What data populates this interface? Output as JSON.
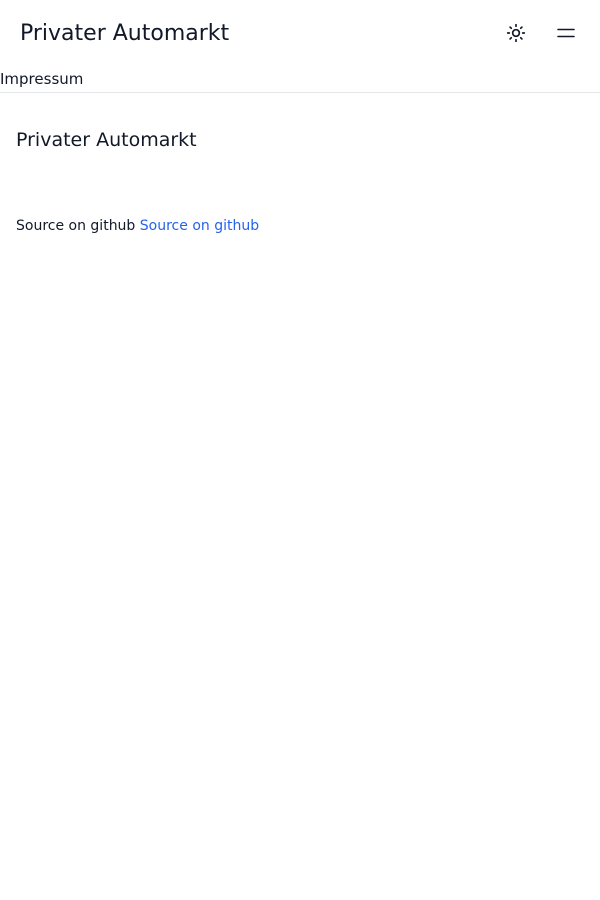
{
  "header": {
    "title": "Privater Automarkt",
    "theme_toggle_icon": "sun-icon",
    "menu_icon": "hamburger-menu-icon"
  },
  "nav": {
    "impressum_label": "Impressum"
  },
  "main": {
    "heading": "Privater Automarkt",
    "source_text": "Source on github",
    "source_link_label": "Source on github"
  },
  "colors": {
    "text": "#111827",
    "link": "#2563eb",
    "divider": "#e5e7eb"
  }
}
